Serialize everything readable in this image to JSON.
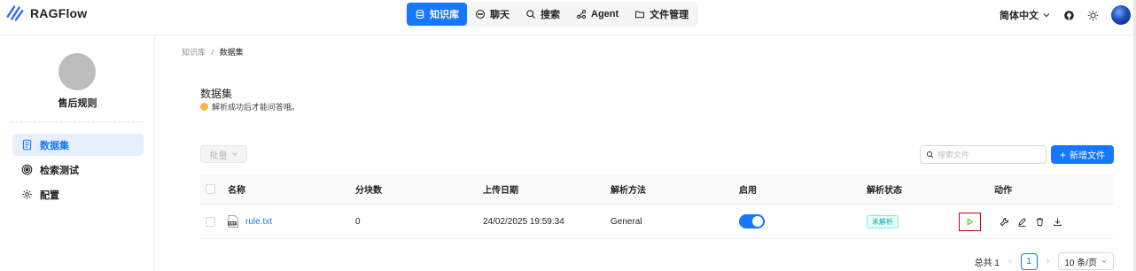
{
  "app": {
    "name": "RAGFlow"
  },
  "nav": {
    "items": [
      {
        "label": "知识库",
        "icon": "database-icon",
        "active": true
      },
      {
        "label": "聊天",
        "icon": "chat-icon",
        "active": false
      },
      {
        "label": "搜索",
        "icon": "search-icon",
        "active": false
      },
      {
        "label": "Agent",
        "icon": "agent-icon",
        "active": false
      },
      {
        "label": "文件管理",
        "icon": "folder-icon",
        "active": false
      }
    ]
  },
  "header": {
    "language": "简体中文"
  },
  "sidebar": {
    "kb_name": "售后规则",
    "items": [
      {
        "label": "数据集",
        "icon": "dataset-icon",
        "active": true
      },
      {
        "label": "检索测试",
        "icon": "retrieval-icon",
        "active": false
      },
      {
        "label": "配置",
        "icon": "gear-icon",
        "active": false
      }
    ]
  },
  "breadcrumb": {
    "parent": "知识库",
    "separator": "/",
    "current": "数据集"
  },
  "page": {
    "title": "数据集",
    "subtitle": "解析成功后才能问答哦。"
  },
  "toolbar": {
    "batch_label": "批量",
    "search_placeholder": "搜索文件",
    "add_label": "新增文件"
  },
  "table": {
    "columns": [
      "名称",
      "分块数",
      "上传日期",
      "解析方法",
      "启用",
      "解析状态",
      "动作"
    ],
    "rows": [
      {
        "name": "rule.txt",
        "chunks": "0",
        "uploaded": "24/02/2025 19:59:34",
        "method": "General",
        "enabled": true,
        "status": "未解析"
      }
    ]
  },
  "pagination": {
    "total_label": "总共 1",
    "current_page": "1",
    "page_size": "10 条/页"
  },
  "colors": {
    "primary": "#1677ff",
    "highlight_border": "#c7000b",
    "status_tag": "#13a8a8"
  }
}
